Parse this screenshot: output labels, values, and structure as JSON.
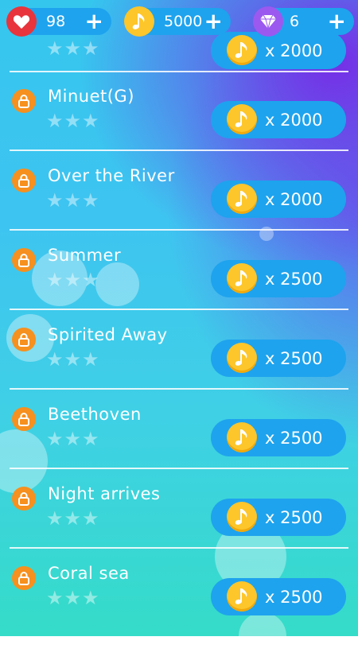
{
  "currency": {
    "lives": {
      "value": "98",
      "icon": "heart-icon",
      "color": "#e8343c"
    },
    "notes": {
      "value": "5000",
      "icon": "music-note-icon",
      "color": "#fdc62a"
    },
    "gems": {
      "value": "6",
      "icon": "diamond-icon",
      "color": "#9b59f0"
    },
    "plus_label": "+"
  },
  "first_price": "x 2000",
  "stars_label": "★★★",
  "songs": [
    {
      "title": "Minuet(G)",
      "price": "x 2000"
    },
    {
      "title": "Over the River",
      "price": "x 2000"
    },
    {
      "title": "Summer",
      "price": "x 2500"
    },
    {
      "title": "Spirited Away",
      "price": "x 2500"
    },
    {
      "title": "Beethoven",
      "price": "x 2500"
    },
    {
      "title": "Night arrives",
      "price": "x 2500"
    },
    {
      "title": "Coral sea",
      "price": "x 2500"
    }
  ]
}
